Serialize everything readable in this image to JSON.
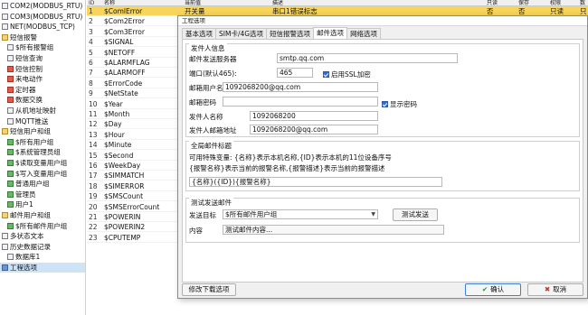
{
  "tree": [
    {
      "label": "COM2(MODBUS_RTU)",
      "icon": "device-icon"
    },
    {
      "label": "COM3(MODBUS_RTU)",
      "icon": "device-icon"
    },
    {
      "label": "NET(MODBUS_TCP)",
      "icon": "device-icon"
    },
    {
      "label": "短信报警",
      "icon": "folder-icon"
    },
    {
      "label": "$所有报警组",
      "icon": "list-icon"
    },
    {
      "label": "短信查询",
      "icon": "list-icon"
    },
    {
      "label": "短信控制",
      "icon": "red-icon"
    },
    {
      "label": "来电动作",
      "icon": "red-icon"
    },
    {
      "label": "定时器",
      "icon": "red-icon"
    },
    {
      "label": "数据交换",
      "icon": "red-icon"
    },
    {
      "label": "从机地址映射",
      "icon": "list-icon"
    },
    {
      "label": "MQTT推送",
      "icon": "list-icon"
    },
    {
      "label": "短信用户和组",
      "icon": "folder-icon"
    },
    {
      "label": "$所有用户组",
      "icon": "user-icon"
    },
    {
      "label": "$系统管理员组",
      "icon": "user-icon"
    },
    {
      "label": "$读取变量用户组",
      "icon": "user-icon"
    },
    {
      "label": "$写入变量用户组",
      "icon": "user-icon"
    },
    {
      "label": "普通用户组",
      "icon": "user-icon"
    },
    {
      "label": "管理员",
      "icon": "user-icon"
    },
    {
      "label": "用户1",
      "icon": "user-icon"
    },
    {
      "label": "邮件用户和组",
      "icon": "folder-icon"
    },
    {
      "label": "$所有邮件用户组",
      "icon": "user-icon"
    },
    {
      "label": "多状态文本",
      "icon": "list-icon"
    },
    {
      "label": "历史数据记录",
      "icon": "list-icon"
    },
    {
      "label": "数据库1",
      "icon": "list-icon"
    },
    {
      "label": "工程选项",
      "icon": "gear-icon"
    }
  ],
  "table": {
    "headers": {
      "idx": "ID",
      "name": "名称",
      "val": "当前值",
      "desc": "描述",
      "a": "只读",
      "b": "保存",
      "c": "权限",
      "d": "数据"
    },
    "rows": [
      {
        "idx": "1",
        "name": "$ComlError",
        "val": "开关量",
        "desc": "串口1错误标志",
        "a": "否",
        "b": "否",
        "c": "只读",
        "d": "只读"
      },
      {
        "idx": "2",
        "name": "$Com2Error",
        "val": "",
        "desc": "",
        "a": "",
        "b": "",
        "c": "",
        "d": ""
      },
      {
        "idx": "3",
        "name": "$Com3Error",
        "val": "",
        "desc": "",
        "a": "",
        "b": "",
        "c": "",
        "d": ""
      },
      {
        "idx": "4",
        "name": "$SIGNAL",
        "val": "",
        "desc": "",
        "a": "",
        "b": "",
        "c": "",
        "d": ""
      },
      {
        "idx": "5",
        "name": "$NETOFF",
        "val": "",
        "desc": "",
        "a": "",
        "b": "",
        "c": "",
        "d": ""
      },
      {
        "idx": "6",
        "name": "$ALARMFLAG",
        "val": "",
        "desc": "",
        "a": "",
        "b": "",
        "c": "",
        "d": ""
      },
      {
        "idx": "7",
        "name": "$ALARMOFF",
        "val": "",
        "desc": "",
        "a": "",
        "b": "",
        "c": "",
        "d": ""
      },
      {
        "idx": "8",
        "name": "$ErrorCode",
        "val": "",
        "desc": "",
        "a": "",
        "b": "",
        "c": "",
        "d": ""
      },
      {
        "idx": "9",
        "name": "$NetState",
        "val": "",
        "desc": "",
        "a": "",
        "b": "",
        "c": "",
        "d": ""
      },
      {
        "idx": "10",
        "name": "$Year",
        "val": "",
        "desc": "",
        "a": "",
        "b": "",
        "c": "",
        "d": ""
      },
      {
        "idx": "11",
        "name": "$Month",
        "val": "",
        "desc": "",
        "a": "",
        "b": "",
        "c": "",
        "d": ""
      },
      {
        "idx": "12",
        "name": "$Day",
        "val": "",
        "desc": "",
        "a": "",
        "b": "",
        "c": "",
        "d": ""
      },
      {
        "idx": "13",
        "name": "$Hour",
        "val": "",
        "desc": "",
        "a": "",
        "b": "",
        "c": "",
        "d": ""
      },
      {
        "idx": "14",
        "name": "$Minute",
        "val": "",
        "desc": "",
        "a": "",
        "b": "",
        "c": "",
        "d": ""
      },
      {
        "idx": "15",
        "name": "$Second",
        "val": "",
        "desc": "",
        "a": "",
        "b": "",
        "c": "",
        "d": ""
      },
      {
        "idx": "16",
        "name": "$WeekDay",
        "val": "",
        "desc": "",
        "a": "",
        "b": "",
        "c": "",
        "d": ""
      },
      {
        "idx": "17",
        "name": "$SIMMATCH",
        "val": "",
        "desc": "",
        "a": "",
        "b": "",
        "c": "",
        "d": ""
      },
      {
        "idx": "18",
        "name": "$SIMERROR",
        "val": "",
        "desc": "",
        "a": "",
        "b": "",
        "c": "",
        "d": ""
      },
      {
        "idx": "19",
        "name": "$SMSCount",
        "val": "",
        "desc": "",
        "a": "",
        "b": "",
        "c": "",
        "d": ""
      },
      {
        "idx": "20",
        "name": "$SMSErrorCount",
        "val": "",
        "desc": "",
        "a": "",
        "b": "",
        "c": "",
        "d": ""
      },
      {
        "idx": "21",
        "name": "$POWERIN",
        "val": "",
        "desc": "",
        "a": "",
        "b": "",
        "c": "",
        "d": ""
      },
      {
        "idx": "22",
        "name": "$POWERIN2",
        "val": "",
        "desc": "",
        "a": "",
        "b": "",
        "c": "",
        "d": ""
      },
      {
        "idx": "23",
        "name": "$CPUTEMP",
        "val": "",
        "desc": "",
        "a": "",
        "b": "",
        "c": "",
        "d": ""
      }
    ]
  },
  "dialog": {
    "title": "工程选项",
    "tabs": [
      "基本选项",
      "SIM卡/4G选项",
      "短信报警选项",
      "邮件选项",
      "网络选项"
    ],
    "active_tab": 3,
    "sender": {
      "group_title": "发件人信息",
      "server_label": "邮件发送服务器",
      "server_value": "smtp.qq.com",
      "port_label": "端口(默认465):",
      "port_value": "465",
      "ssl_label": "启用SSL加密",
      "user_label": "邮箱用户名",
      "user_value": "1092068200@qq.com",
      "password_label": "邮箱密码",
      "password_value": "",
      "show_password_label": "显示密码",
      "sender_name_label": "发件人名称",
      "sender_name_value": "1092068200",
      "sender_addr_label": "发件人邮箱地址",
      "sender_addr_value": "1092068200@qq.com"
    },
    "subject": {
      "group_title": "全局邮件标题",
      "hint1": "可用特殊变量: {名称}表示本机名称,{ID}表示本机的11位设备序号",
      "hint2": "{报警名称}表示当前的报警名称,{报警描述}表示当前的报警描述",
      "value": "{名称}({ID}){报警名称}"
    },
    "test": {
      "group_title": "测试发送邮件",
      "target_label": "发送目标",
      "target_value": "$所有邮件用户组",
      "send_button": "测试发送",
      "content_label": "内容",
      "content_value": "测试邮件内容..."
    },
    "modify_button": "修改下载选项",
    "ok_button": "确认",
    "cancel_button": "取消"
  }
}
